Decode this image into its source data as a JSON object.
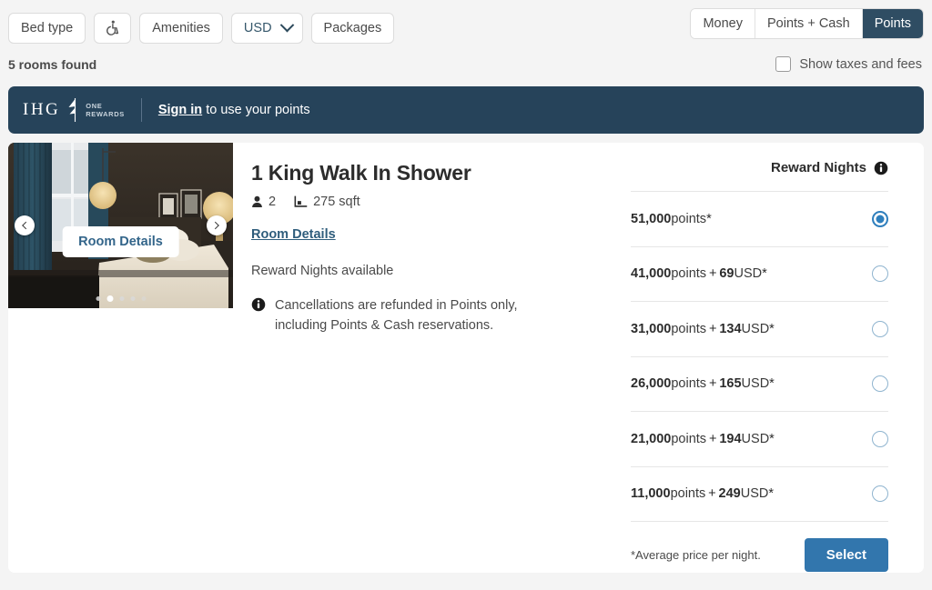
{
  "filters": {
    "chips": [
      {
        "label": "Bed type",
        "icon": null
      },
      {
        "label": "",
        "icon": "wheelchair-accessible-icon"
      },
      {
        "label": "Amenities",
        "icon": null
      },
      {
        "label": "USD",
        "icon": "chevron-down-icon"
      },
      {
        "label": "Packages",
        "icon": null
      }
    ],
    "currency_selected": "USD"
  },
  "rate_toggle": {
    "options": [
      "Money",
      "Points + Cash",
      "Points"
    ],
    "selected": "Points"
  },
  "results": {
    "count_label": "5 rooms found",
    "taxes_label": "Show taxes and fees",
    "taxes_checked": false
  },
  "banner": {
    "brand": "IHG",
    "program_line1": "ONE",
    "program_line2": "REWARDS",
    "signin_link": "Sign in",
    "signin_rest": " to use your points"
  },
  "room": {
    "title": "1 King Walk In Shower",
    "occupancy_icon": "person-icon",
    "occupancy": "2",
    "size_icon": "floorplan-icon",
    "size": "275 sqft",
    "details_link": "Room Details",
    "overlay_button": "Room Details",
    "reward_availability": "Reward Nights available",
    "cancellation_icon": "info-icon",
    "cancellation_note": "Cancellations are refunded in Points only, including Points & Cash reservations.",
    "carousel": {
      "prev_icon": "chevron-left-icon",
      "next_icon": "chevron-right-icon",
      "dot_count": 5,
      "active_dot": 2
    }
  },
  "pricing": {
    "header_label": "Reward Nights",
    "header_icon": "info-icon",
    "footnote": "*Average price per night.",
    "select_label": "Select",
    "rates": [
      {
        "points": "51,000",
        "points_unit": "points",
        "plus": false,
        "cash": "",
        "cash_unit": "",
        "asterisk": "*",
        "selected": true
      },
      {
        "points": "41,000",
        "points_unit": "points",
        "plus": true,
        "cash": "69",
        "cash_unit": "USD",
        "asterisk": "*",
        "selected": false
      },
      {
        "points": "31,000",
        "points_unit": "points",
        "plus": true,
        "cash": "134",
        "cash_unit": "USD",
        "asterisk": "*",
        "selected": false
      },
      {
        "points": "26,000",
        "points_unit": "points",
        "plus": true,
        "cash": "165",
        "cash_unit": "USD",
        "asterisk": "*",
        "selected": false
      },
      {
        "points": "21,000",
        "points_unit": "points",
        "plus": true,
        "cash": "194",
        "cash_unit": "USD",
        "asterisk": "*",
        "selected": false
      },
      {
        "points": "11,000",
        "points_unit": "points",
        "plus": true,
        "cash": "249",
        "cash_unit": "USD",
        "asterisk": "*",
        "selected": false
      }
    ]
  },
  "colors": {
    "banner_bg": "#26435a",
    "toggle_active_bg": "#2f4d63",
    "select_button_bg": "#3276ad",
    "radio_selected": "#2f7fbd",
    "link": "#2f5d7c",
    "page_bg": "#f4f4f4"
  }
}
